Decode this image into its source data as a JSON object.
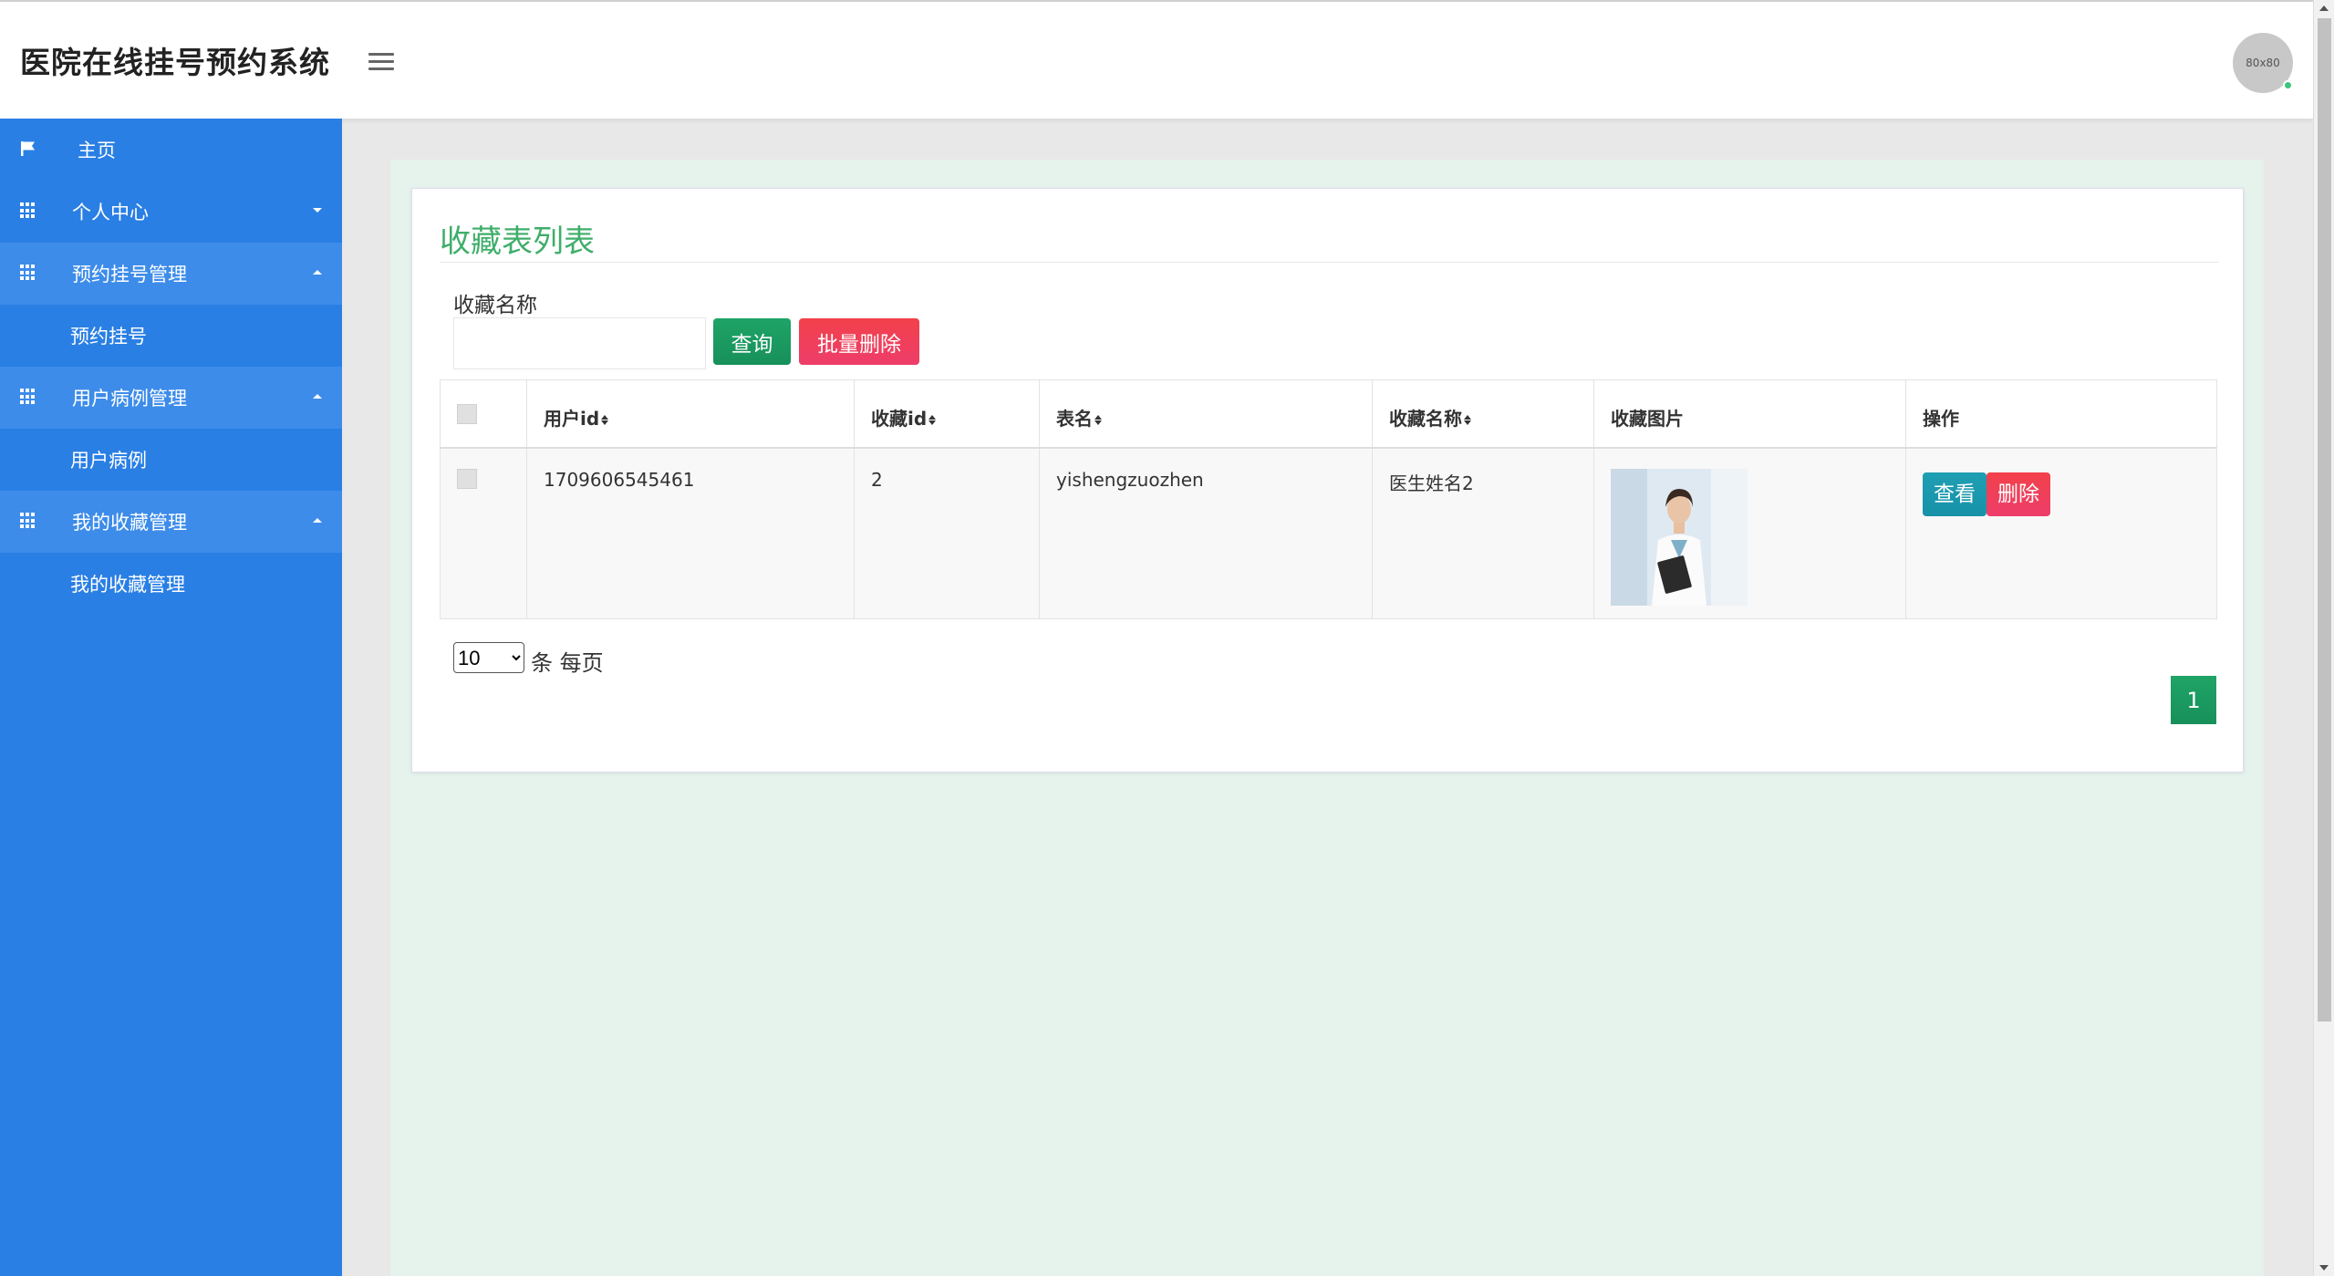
{
  "header": {
    "brand": "医院在线挂号预约系统",
    "avatar_text": "80x80",
    "status_color": "#3cc47c"
  },
  "sidebar": {
    "items": [
      {
        "label": "主页",
        "icon": "flag-icon",
        "type": "link"
      },
      {
        "label": "个人中心",
        "icon": "grid-icon",
        "type": "parent",
        "expanded": false
      },
      {
        "label": "预约挂号管理",
        "icon": "grid-icon",
        "type": "parent",
        "expanded": true
      },
      {
        "label": "预约挂号",
        "type": "child"
      },
      {
        "label": "用户病例管理",
        "icon": "grid-icon",
        "type": "parent",
        "expanded": true
      },
      {
        "label": "用户病例",
        "type": "child"
      },
      {
        "label": "我的收藏管理",
        "icon": "grid-icon",
        "type": "parent",
        "expanded": true
      },
      {
        "label": "我的收藏管理",
        "type": "child"
      }
    ],
    "color": "#2a7fe4"
  },
  "main": {
    "title": "收藏表列表",
    "search": {
      "label": "收藏名称",
      "value": "",
      "placeholder": ""
    },
    "buttons": {
      "query": "查询",
      "batch_delete": "批量删除"
    },
    "table": {
      "columns": [
        "用户id",
        "收藏id",
        "表名",
        "收藏名称",
        "收藏图片",
        "操作"
      ],
      "rows": [
        {
          "user_id": "1709606545461",
          "fav_id": "2",
          "table_name": "yishengzuozhen",
          "fav_name": "医生姓名2",
          "image": "doctor-photo",
          "actions": {
            "view": "查看",
            "delete": "删除"
          }
        }
      ]
    },
    "pagination": {
      "page_size": "10",
      "page_size_options": [
        "10"
      ],
      "suffix": "条 每页",
      "current_page": "1"
    },
    "accent_color": "#3fae6a"
  }
}
